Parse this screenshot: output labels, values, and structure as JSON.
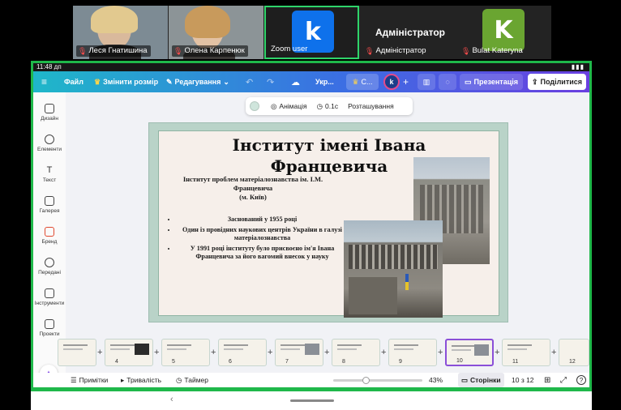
{
  "zoom": {
    "participants": [
      {
        "name": "Леся Гнатишина",
        "mic_muted": true
      },
      {
        "name": "Олена Карпенюк",
        "mic_muted": true
      },
      {
        "name": "Zoom user",
        "mic_muted": false,
        "avatar_letter": "k",
        "avatar_color": "#0e71eb",
        "active_speaker": true
      },
      {
        "name": "Адміністратор",
        "display_name": "Адміністратор",
        "mic_muted": true
      },
      {
        "name": "Bulat Kateryna",
        "mic_muted": true,
        "avatar_letter": "K",
        "avatar_color": "#6aa531"
      }
    ]
  },
  "statusbar": {
    "time": "11:48 дп"
  },
  "toolbar": {
    "menu_icon": "menu-icon",
    "file": "Файл",
    "resize": "Змінити розмір",
    "editing": "Редагування",
    "doc_title": "Укр...",
    "collab_label": "С...",
    "avatar_letter": "k",
    "present": "Презентація",
    "share": "Поділитися"
  },
  "rail": [
    {
      "label": "Дизайн",
      "icon": "design-icon"
    },
    {
      "label": "Елементи",
      "icon": "elements-icon"
    },
    {
      "label": "Текст",
      "icon": "text-icon"
    },
    {
      "label": "Галерея",
      "icon": "gallery-icon"
    },
    {
      "label": "Бренд",
      "icon": "brand-icon"
    },
    {
      "label": "Передані",
      "icon": "uploads-icon"
    },
    {
      "label": "Інструменти",
      "icon": "tools-icon"
    },
    {
      "label": "Проекти",
      "icon": "projects-icon"
    }
  ],
  "subbar": {
    "animation": "Анімація",
    "duration": "0.1с",
    "position": "Розташування"
  },
  "slide": {
    "title": "Інститут імені Івана Францевича",
    "subtitle_lines": [
      "Інститут проблем матеріалознавства ім. І.М.",
      "Францевича",
      "(м. Київ)"
    ],
    "bullets": [
      "Заснований у 1955 році",
      "Один із провідних наукових центрів України в галузі матеріалознавства",
      "У 1991 році інституту було присвоєно ім'я Івана Францевича за його вагомий внесок у науку"
    ],
    "colors": {
      "frame": "#b9d3c8",
      "paper": "#f6efea"
    }
  },
  "thumbnails": [
    {
      "num": ""
    },
    {
      "num": "4"
    },
    {
      "num": "5"
    },
    {
      "num": "6"
    },
    {
      "num": "7"
    },
    {
      "num": "8"
    },
    {
      "num": "9"
    },
    {
      "num": "10"
    },
    {
      "num": "11"
    },
    {
      "num": "12"
    }
  ],
  "bottombar": {
    "notes": "Примітки",
    "duration": "Тривалість",
    "timer": "Таймер",
    "zoom": "43%",
    "pages": "Сторінки",
    "page_count": "10 з 12",
    "help": "?"
  }
}
